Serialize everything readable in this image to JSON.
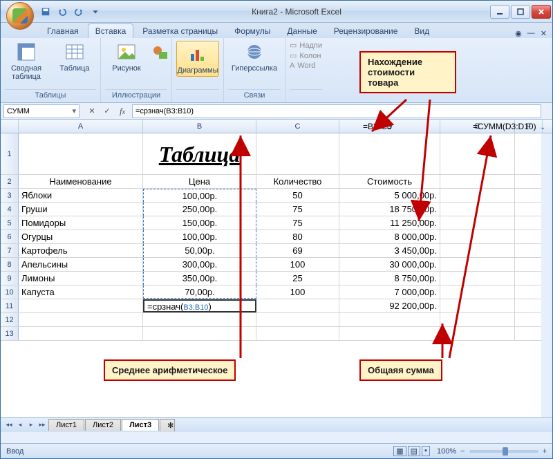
{
  "window": {
    "title": "Книга2 - Microsoft Excel"
  },
  "ribbon_tabs": [
    "Главная",
    "Вставка",
    "Разметка страницы",
    "Формулы",
    "Данные",
    "Рецензирование",
    "Вид"
  ],
  "active_tab": "Вставка",
  "ribbon": {
    "group_tables": "Таблицы",
    "pivot": "Сводная\nтаблица",
    "table": "Таблица",
    "group_illus": "Иллюстрации",
    "picture": "Рисунок",
    "group_charts": "",
    "charts": "Диаграммы",
    "hyperlink": "Гиперссылка",
    "group_links": "Связи",
    "mini": {
      "a": "Надпи",
      "b": "Колон",
      "c": "Word"
    }
  },
  "name_box": "СУММ",
  "formula": "=срзнач(B3:B10)",
  "extra_formula_d": "=B3*C3",
  "extra_formula_e": "=СУММ(D3:D10)",
  "col_widths": {
    "A": 180,
    "B": 164,
    "C": 120,
    "D": 146,
    "E": 108,
    "F": 40
  },
  "columns": [
    "A",
    "B",
    "C",
    "D",
    "E",
    "F"
  ],
  "table": {
    "title": "Таблица",
    "headers": {
      "name": "Наименование",
      "price": "Цена",
      "qty": "Количество",
      "cost": "Стоимость"
    },
    "rows": [
      {
        "n": "Яблоки",
        "p": "100,00р.",
        "q": "50",
        "c": "5 000,00р."
      },
      {
        "n": "Груши",
        "p": "250,00р.",
        "q": "75",
        "c": "18 750,00р."
      },
      {
        "n": "Помидоры",
        "p": "150,00р.",
        "q": "75",
        "c": "11 250,00р."
      },
      {
        "n": "Огурцы",
        "p": "100,00р.",
        "q": "80",
        "c": "8 000,00р."
      },
      {
        "n": "Картофель",
        "p": "50,00р.",
        "q": "69",
        "c": "3 450,00р."
      },
      {
        "n": "Апельсины",
        "p": "300,00р.",
        "q": "100",
        "c": "30 000,00р."
      },
      {
        "n": "Лимоны",
        "p": "350,00р.",
        "q": "25",
        "c": "8 750,00р."
      },
      {
        "n": "Капуста",
        "p": "70,00р.",
        "q": "100",
        "c": "7 000,00р."
      }
    ],
    "b11": "=срзнач(B3:B10)",
    "d11": "92 200,00р."
  },
  "sheets": [
    "Лист1",
    "Лист2",
    "Лист3"
  ],
  "active_sheet": "Лист3",
  "status": "Ввод",
  "zoom": "100%",
  "callouts": {
    "top": "Нахождение\nстоимости\nтовара",
    "left": "Среднее арифметическое",
    "right": "Общаяя сумма"
  }
}
